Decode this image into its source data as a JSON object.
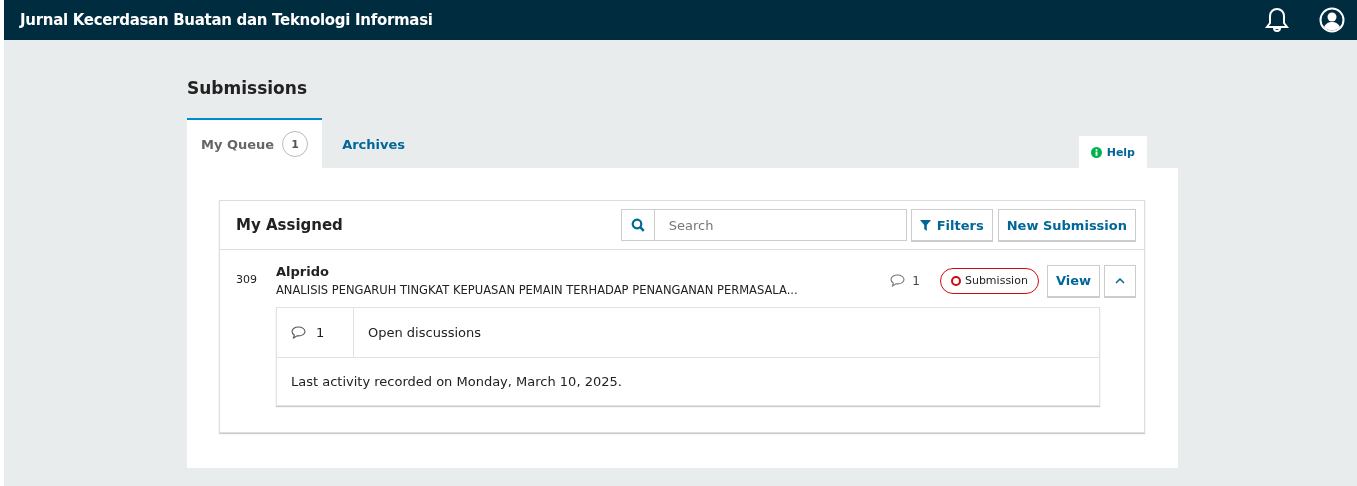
{
  "header": {
    "title": "Jurnal Kecerdasan Buatan dan Teknologi Informasi"
  },
  "page_title": "Submissions",
  "tabs": [
    {
      "label": "My Queue",
      "count": "1",
      "selected": true
    },
    {
      "label": "Archives",
      "selected": false
    }
  ],
  "help": {
    "label": "Help"
  },
  "list": {
    "title": "My Assigned",
    "search": {
      "placeholder": "Search"
    },
    "filters_button": "Filters",
    "new_button": "New Submission",
    "items": [
      {
        "id": "309",
        "author": "Alprido",
        "title": "ANALISIS PENGARUH TINGKAT KEPUASAN PEMAIN TERHADAP PENANGANAN PERMASALA...",
        "comments": "1",
        "stage": "Submission",
        "view_button": "View",
        "expanded": true,
        "details": {
          "discussions_count": "1",
          "discussions_label": "Open discussions",
          "last_activity": "Last activity recorded on Monday, March 10, 2025."
        }
      }
    ]
  }
}
